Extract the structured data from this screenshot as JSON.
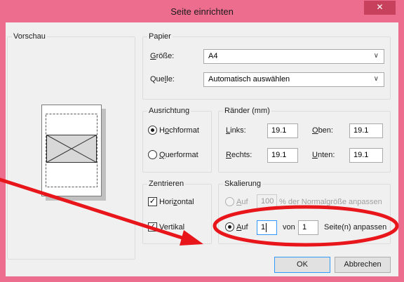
{
  "window": {
    "title": "Seite einrichten",
    "close_symbol": "✕"
  },
  "preview": {
    "group_label": "Vorschau"
  },
  "paper": {
    "group_label": "Papier",
    "size_label_u": "G",
    "size_label_rest": "röße:",
    "size_value": "A4",
    "source_label_pre": "Que",
    "source_label_u": "l",
    "source_label_rest": "le:",
    "source_value": "Automatisch auswählen"
  },
  "orientation": {
    "group_label": "Ausrichtung",
    "portrait_pre": "H",
    "portrait_u": "o",
    "portrait_rest": "chformat",
    "landscape_u": "Q",
    "landscape_rest": "uerformat",
    "selected": "portrait"
  },
  "margins": {
    "group_label": "Ränder (mm)",
    "left_u": "L",
    "left_rest": "inks:",
    "left_value": "19.1",
    "top_u": "O",
    "top_rest": "ben:",
    "top_value": "19.1",
    "right_u": "R",
    "right_rest": "echts:",
    "right_value": "19.1",
    "bottom_u": "U",
    "bottom_rest": "nten:",
    "bottom_value": "19.1"
  },
  "center": {
    "group_label": "Zentrieren",
    "horizontal_pre": "Hori",
    "horizontal_u": "z",
    "horizontal_rest": "ontal",
    "horizontal_checked": true,
    "vertical_u": "V",
    "vertical_rest": "ertikal",
    "vertical_checked": true,
    "check_symbol": "✓"
  },
  "scaling": {
    "group_label": "Skalierung",
    "percent_label_u": "A",
    "percent_label_rest": "uf",
    "percent_value": "100",
    "percent_suffix": "% der Normalgröße anpassen",
    "fit_label_u": "A",
    "fit_label_rest": "uf",
    "fit_value": "1",
    "fit_of": "von",
    "fit_pages": "1",
    "fit_suffix": "Seite(n) anpassen",
    "selected": "fit"
  },
  "buttons": {
    "ok": "OK",
    "cancel": "Abbrechen"
  },
  "colors": {
    "titlebar": "#ec6d8e",
    "close_button": "#c7405c",
    "annotation": "#e8151b"
  }
}
